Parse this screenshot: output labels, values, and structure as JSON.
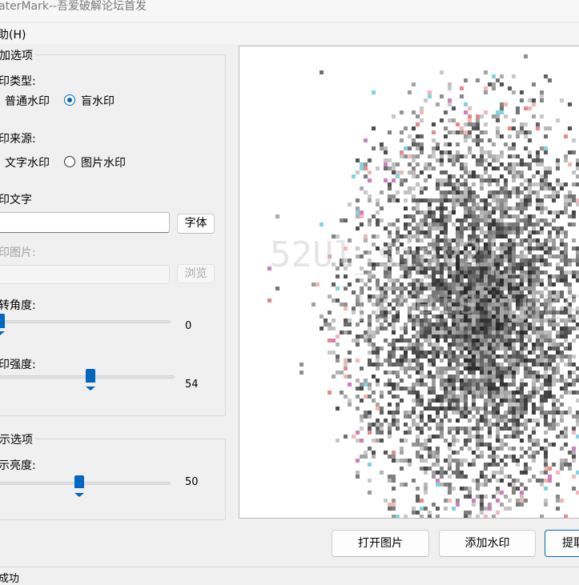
{
  "window": {
    "title": "aterMark--吾爱破解论坛首发"
  },
  "menu": {
    "help": "助(H)"
  },
  "watermark_options": {
    "legend": "加选项",
    "type_label": "印类型:",
    "type_normal": "普通水印",
    "type_blind": "盲水印",
    "type_selected": "盲水印",
    "source_label": "印来源:",
    "source_text": "文字水印",
    "source_image": "图片水印",
    "source_selected": "",
    "text_label": "印文字",
    "text_value": "",
    "font_button": "字体",
    "image_label": "印图片:",
    "image_value": "",
    "browse_button": "浏览",
    "angle_label": "转角度:",
    "angle_value": "0",
    "strength_label": "印强度:",
    "strength_value": "54"
  },
  "display_options": {
    "legend": "示选项",
    "brightness_label": "示亮度:",
    "brightness_value": "50"
  },
  "buttons": {
    "open_image": "打开图片",
    "add_watermark": "添加水印",
    "extract": "提取"
  },
  "status": {
    "text": "成功"
  },
  "preview": {
    "watermark_text_line1": "52Ul_siav2|_",
    "watermark_text_line2": "52Ul_siav2|_"
  },
  "colors": {
    "accent": "#0067c0",
    "window_bg": "#f0f0f0"
  }
}
